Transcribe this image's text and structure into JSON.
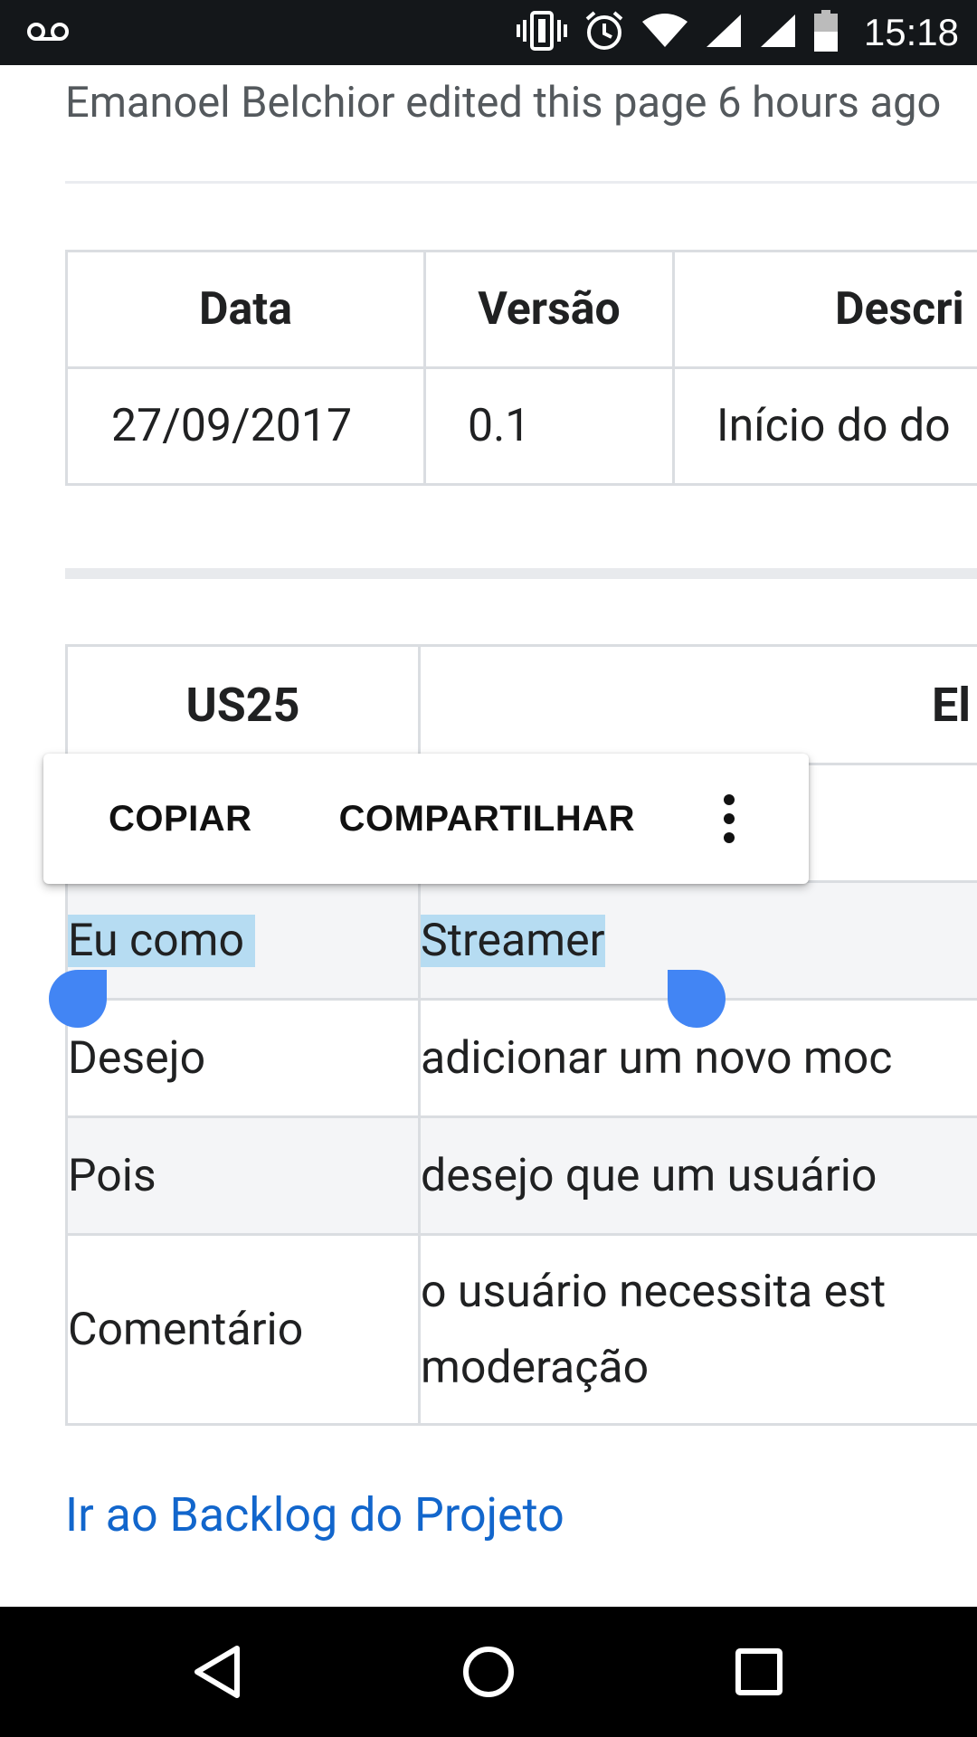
{
  "status_bar": {
    "time": "15:18",
    "icons": [
      "voicemail-icon",
      "vibrate-icon",
      "alarm-icon",
      "wifi-icon",
      "signal-icon",
      "signal-icon",
      "battery-icon"
    ]
  },
  "page": {
    "edited_text": "Emanoel Belchior edited this page 6 hours ago",
    "history_table": {
      "headers": [
        "Data",
        "Versão",
        "Descri"
      ],
      "rows": [
        [
          "27/09/2017",
          "0.1",
          "Início do do"
        ]
      ]
    },
    "story_table": {
      "header": [
        "US25",
        "El"
      ],
      "rows": [
        [
          "",
          ""
        ],
        [
          "Eu como",
          "Streamer"
        ],
        [
          "Desejo",
          "adicionar um novo moc"
        ],
        [
          "Pois",
          "desejo que um usuário"
        ],
        [
          "Comentário",
          "o usuário necessita est",
          "moderação"
        ]
      ]
    },
    "link_text": "Ir ao Backlog do Projeto"
  },
  "selection_popup": {
    "copy_label": "COPIAR",
    "share_label": "COMPARTILHAR",
    "more_icon": "more-vert-icon"
  },
  "nav_bar": {
    "icons": [
      "back-icon",
      "home-icon",
      "recents-icon"
    ]
  },
  "colors": {
    "link": "#1266cc",
    "selection": "#b6dcf2",
    "handle": "#4285f4",
    "status_bar_bg": "#14171a"
  }
}
